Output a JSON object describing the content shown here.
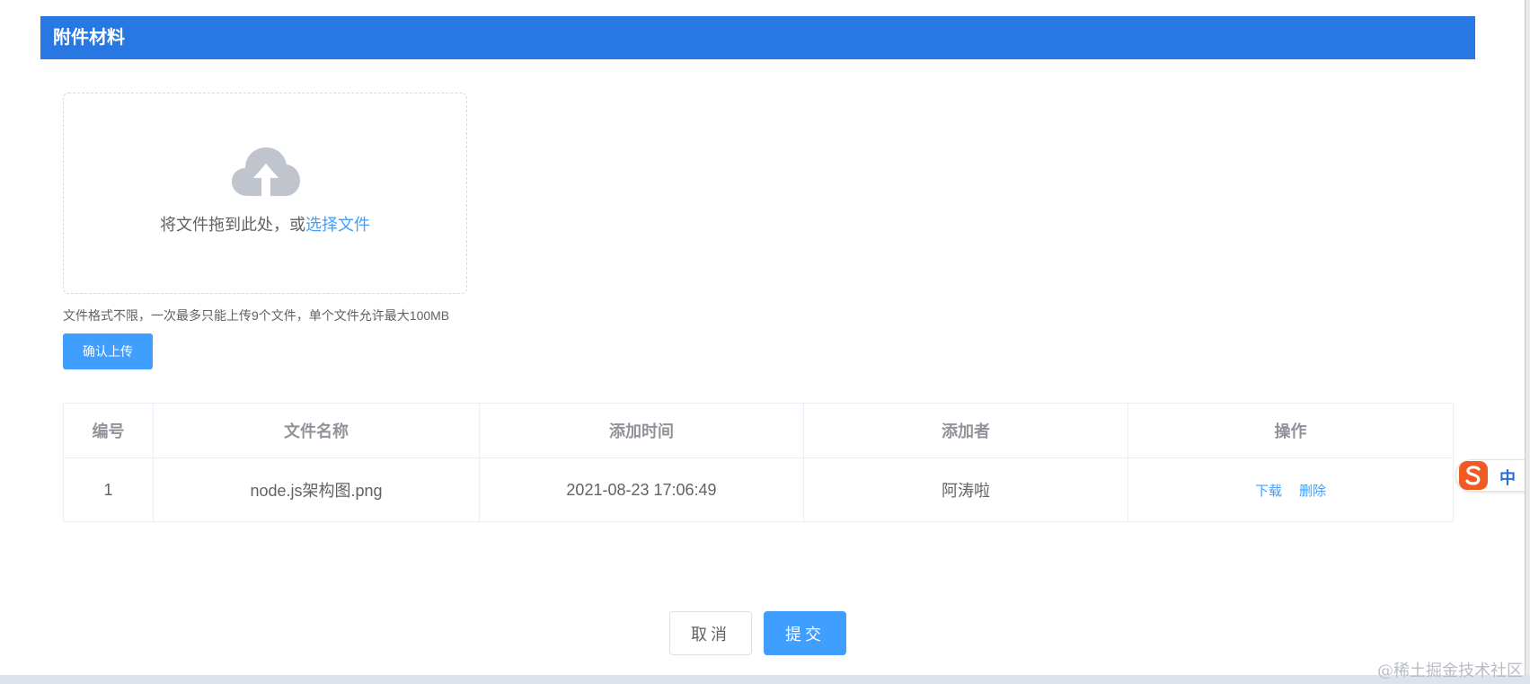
{
  "section": {
    "title": "附件材料"
  },
  "upload": {
    "drop_text": "将文件拖到此处，或",
    "select_link": "选择文件",
    "tip": "文件格式不限，一次最多只能上传9个文件，单个文件允许最大100MB",
    "confirm_label": "确认上传",
    "icon": "cloud-upload-icon"
  },
  "table": {
    "headers": [
      "编号",
      "文件名称",
      "添加时间",
      "添加者",
      "操作"
    ],
    "rows": [
      {
        "id": "1",
        "name": "node.js架构图.png",
        "time": "2021-08-23 17:06:49",
        "author": "阿涛啦",
        "actions": [
          "下载",
          "删除"
        ]
      }
    ]
  },
  "footer": {
    "cancel_label": "取消",
    "submit_label": "提交"
  },
  "ime": {
    "mode": "中"
  },
  "watermark": "@稀土掘金技术社区",
  "colors": {
    "header_bg": "#2878e3",
    "primary": "#409eff",
    "text": "#606266"
  }
}
